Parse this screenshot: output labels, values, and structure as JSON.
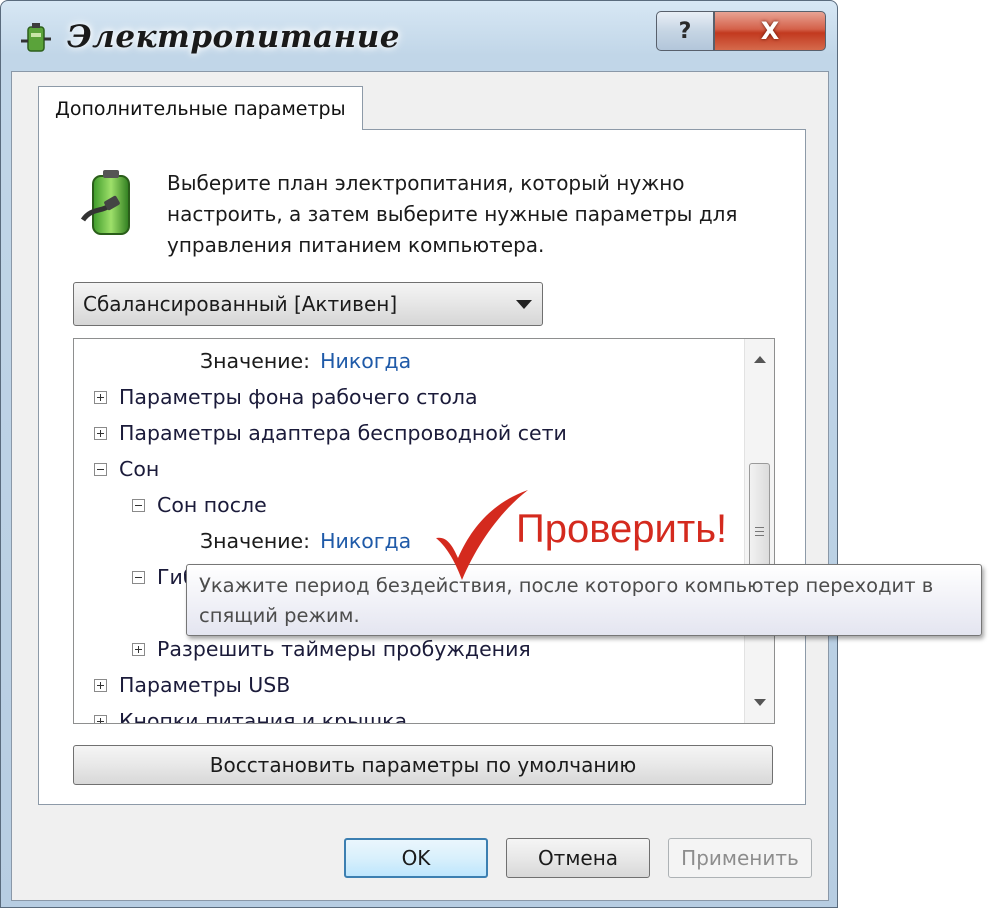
{
  "window": {
    "title": "Электропитание",
    "help_label": "?",
    "close_label": "X",
    "icon": "power-options-icon"
  },
  "tab": {
    "label": "Дополнительные параметры"
  },
  "panel": {
    "icon": "battery-plug-icon",
    "description": "Выберите план электропитания, который нужно\nнастроить, а затем выберите нужные параметры для\nуправления питанием компьютера."
  },
  "plan_select": {
    "value": "Сбалансированный [Активен]"
  },
  "tree": {
    "rows": [
      {
        "type": "value",
        "label": "Значение:",
        "value": "Никогда"
      },
      {
        "type": "node",
        "expander": "plus",
        "label": "Параметры фона рабочего стола"
      },
      {
        "type": "node",
        "expander": "plus",
        "label": "Параметры адаптера беспроводной сети"
      },
      {
        "type": "node",
        "expander": "minus",
        "label": "Сон"
      },
      {
        "type": "node",
        "expander": "minus",
        "label": "Сон после"
      },
      {
        "type": "value",
        "label": "Значение:",
        "value": "Никогда"
      },
      {
        "type": "node",
        "expander": "minus",
        "label": "Гиб"
      },
      {
        "type": "node",
        "expander": "plus",
        "label": "Разрешить таймеры пробуждения"
      },
      {
        "type": "node",
        "expander": "plus",
        "label": "Параметры USB"
      },
      {
        "type": "node",
        "expander": "plus",
        "label": "Кнопки питания и крышка"
      }
    ]
  },
  "tooltip": {
    "text": "Укажите период бездействия, после которого компьютер переходит в\nспящий режим."
  },
  "buttons": {
    "restore": "Восстановить параметры по умолчанию",
    "ok": "OK",
    "cancel": "Отмена",
    "apply": "Применить"
  },
  "annotation": {
    "text": "Проверить!",
    "color": "#d42a1e"
  }
}
